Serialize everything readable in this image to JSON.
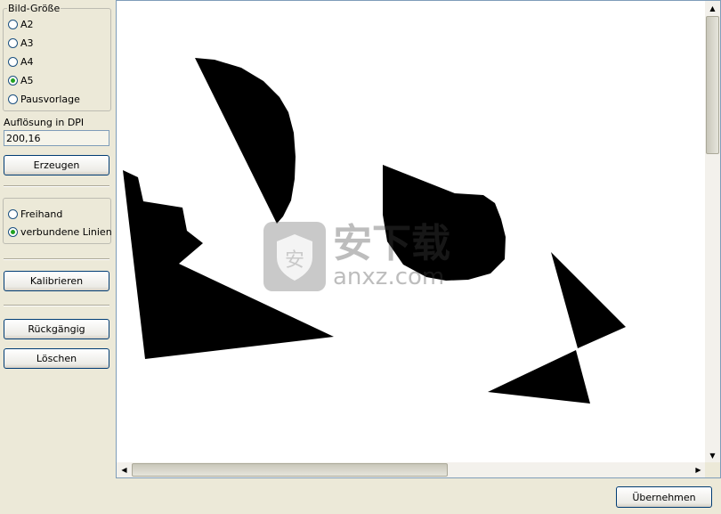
{
  "sidebar": {
    "size_group": {
      "legend": "Bild-Größe",
      "options": [
        {
          "label": "A2",
          "checked": false
        },
        {
          "label": "A3",
          "checked": false
        },
        {
          "label": "A4",
          "checked": false
        },
        {
          "label": "A5",
          "checked": true
        },
        {
          "label": "Pausvorlage",
          "checked": false
        }
      ]
    },
    "dpi_label": "Auflösung in DPI",
    "dpi_value": "200,16",
    "generate_button": "Erzeugen",
    "mode_group": {
      "options": [
        {
          "label": "Freihand",
          "checked": false
        },
        {
          "label": "verbundene Linien",
          "checked": true
        }
      ]
    },
    "calibrate_button": "Kalibrieren",
    "undo_button": "Rückgängig",
    "delete_button": "Löschen"
  },
  "footer": {
    "ok_button": "Übernehmen"
  },
  "watermark": {
    "brand": "安下载",
    "domain": "anxz.com"
  },
  "colors": {
    "window_bg": "#ece9d8",
    "shape_fill": "#000000",
    "canvas_bg": "#ffffff",
    "radio_checked": "#21a121"
  }
}
